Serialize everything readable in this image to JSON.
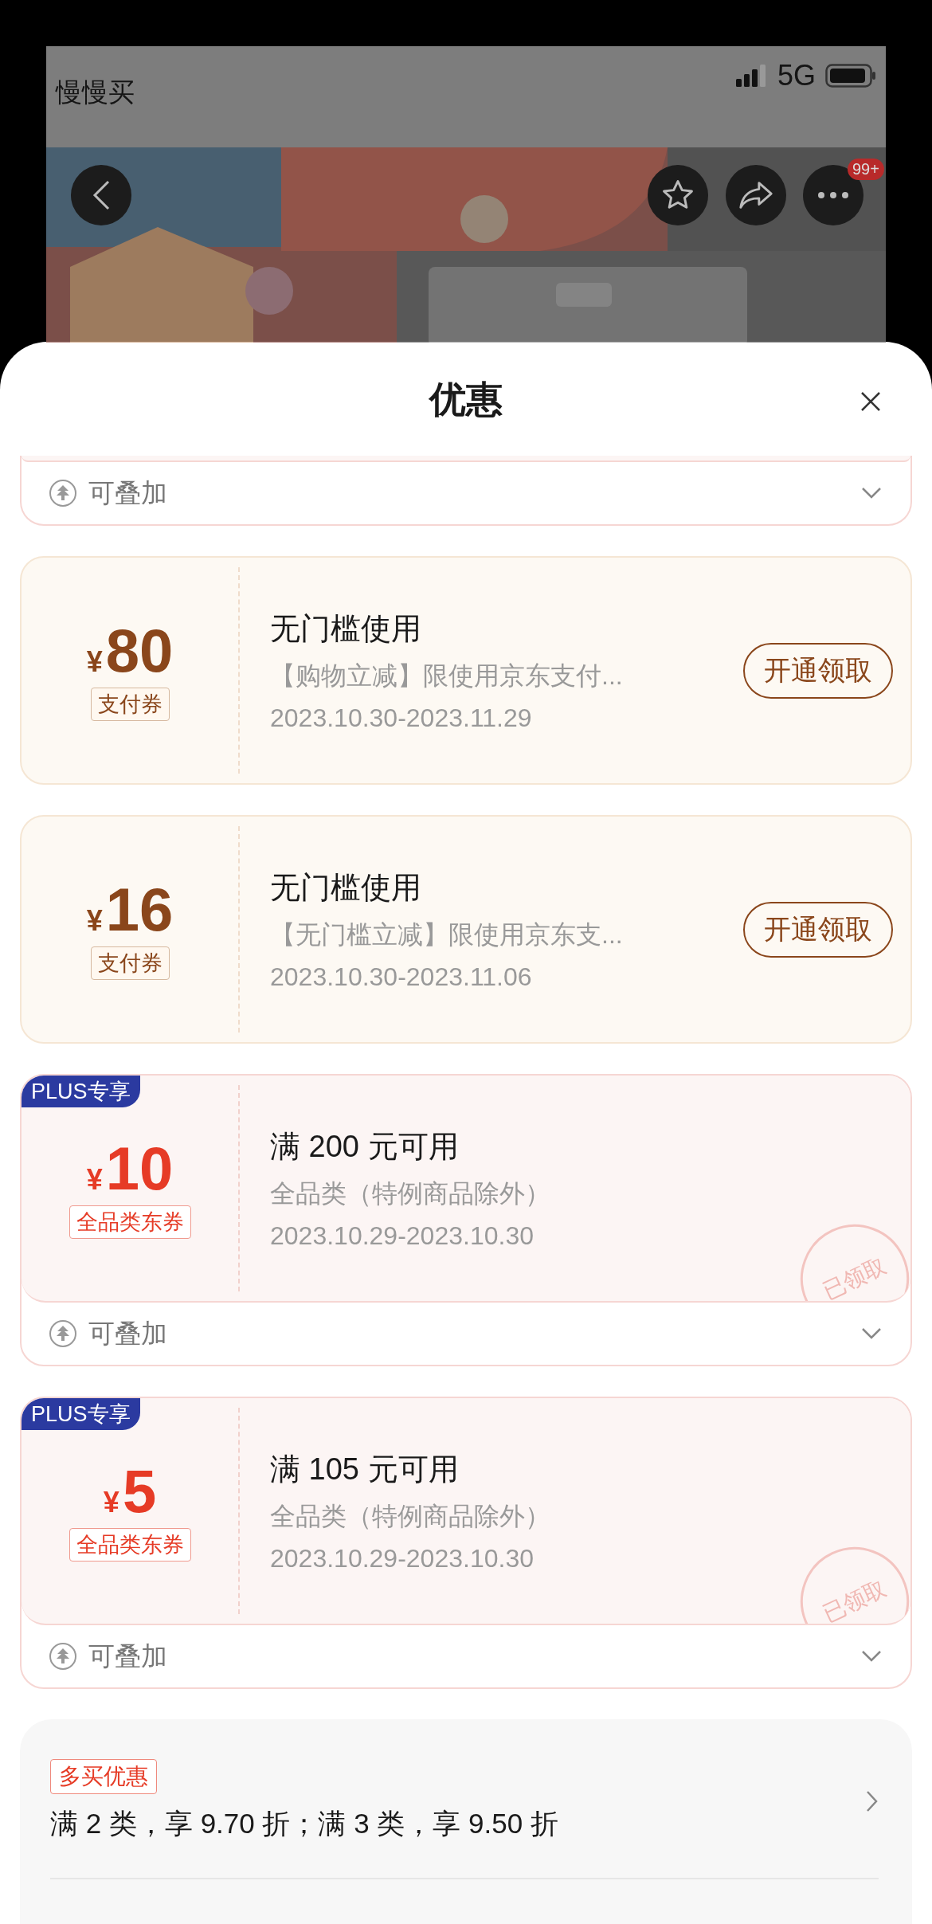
{
  "background_app": {
    "shop_name": "慢慢买",
    "network": "5G",
    "badge": "99+"
  },
  "sheet": {
    "title": "优惠"
  },
  "partial_coupon": {
    "stack_label": "可叠加"
  },
  "coupons": [
    {
      "kind": "pay",
      "currency": "¥",
      "amount": "80",
      "tag": "支付券",
      "title": "无门槛使用",
      "description": "【购物立减】限使用京东支付...",
      "dates": "2023.10.30-2023.11.29",
      "action": "开通领取"
    },
    {
      "kind": "pay",
      "currency": "¥",
      "amount": "16",
      "tag": "支付券",
      "title": "无门槛使用",
      "description": "【无门槛立减】限使用京东支...",
      "dates": "2023.10.30-2023.11.06",
      "action": "开通领取"
    },
    {
      "kind": "plus",
      "badge": "PLUS专享",
      "currency": "¥",
      "amount": "10",
      "tag": "全品类东券",
      "title": "满 200 元可用",
      "description": "全品类（特例商品除外）",
      "dates": "2023.10.29-2023.10.30",
      "stamp": "已领取",
      "stack_label": "可叠加"
    },
    {
      "kind": "plus",
      "badge": "PLUS专享",
      "currency": "¥",
      "amount": "5",
      "tag": "全品类东券",
      "title": "满 105 元可用",
      "description": "全品类（特例商品除外）",
      "dates": "2023.10.29-2023.10.30",
      "stamp": "已领取",
      "stack_label": "可叠加"
    }
  ],
  "promotions": [
    {
      "tag": "多买优惠",
      "text": "满 2 类，享 9.70 折；满 3 类，享 9.50 折"
    }
  ]
}
